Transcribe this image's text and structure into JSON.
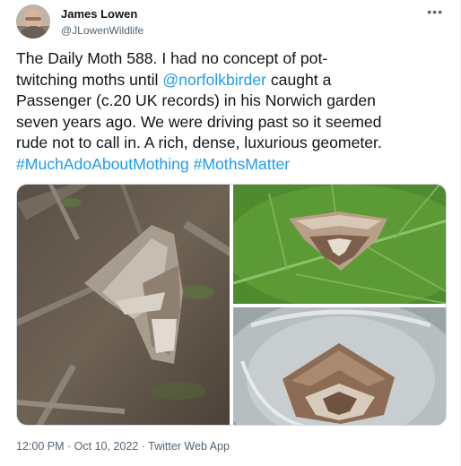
{
  "author": {
    "display_name": "James Lowen",
    "handle": "@JLowenWildlife"
  },
  "tweet": {
    "text_1": "The Daily Moth 588. I had no concept of pot-\ntwitching moths until ",
    "mention": "@norfolkbirder",
    "text_2": " caught a\nPassenger (c.20 UK records) in his Norwich garden\nseven years ago. We were driving past so it seemed\nrude not to call in. A rich, dense, luxurious geometer.\n",
    "hashtag_1": "#MuchAdoAboutMothing",
    "hashtag_2": "#MothsMatter"
  },
  "meta": {
    "time": "12:00 PM",
    "separator": "·",
    "date": "Oct 10, 2022",
    "source": "Twitter Web App"
  },
  "icons": {
    "more": "more-horizontal-icon"
  },
  "colors": {
    "link": "#1d9bf0",
    "text": "#0f1419",
    "muted": "#536471"
  }
}
